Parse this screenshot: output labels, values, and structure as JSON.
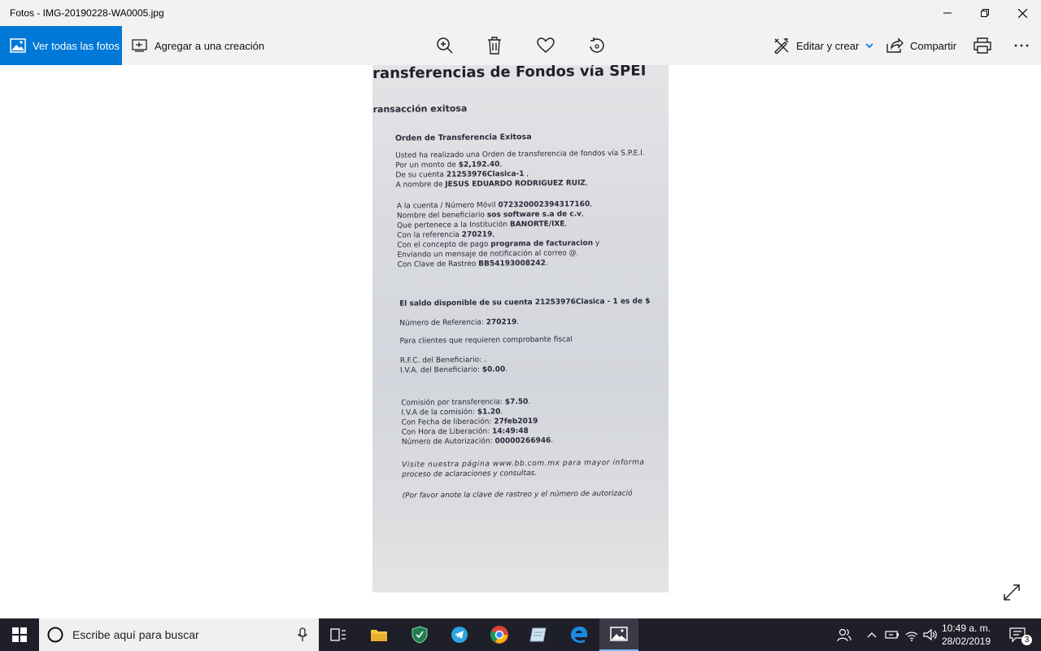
{
  "window": {
    "title": "Fotos - IMG-20190228-WA0005.jpg"
  },
  "toolbar": {
    "see_all": "Ver todas las fotos",
    "add_to_creation": "Agregar a una creación",
    "edit_create": "Editar y crear",
    "share": "Compartir"
  },
  "document": {
    "heading": "ransferencias de Fondos vía SPEI",
    "status": "ransacción exitosa",
    "order_title": "Orden de Transferencia Exitosa",
    "p1": "Usted ha realizado una Orden de transferencia de fondos vía S.P.E.I.",
    "amount_label": "Por un monto de ",
    "amount": "$2,192.40",
    "account_label": "De su cuenta ",
    "account": "21253976Clasica-1",
    "name_label": "A nombre de ",
    "name": "JESUS EDUARDO RODRIGUEZ RUIZ",
    "dest_label": "A la cuenta / Número Móvil ",
    "dest": "072320002394317160",
    "benef_label": "Nombre del beneficiario ",
    "benef": "sos software s.a de c.v",
    "inst_label": "Que pertenece a la Institución ",
    "inst": "BANORTE/IXE",
    "ref_label": "Con la referencia ",
    "ref": "270219",
    "concept_label": "Con el concepto de pago ",
    "concept": "programa de facturacion",
    "concept_tail": " y",
    "notify": "Enviando un mensaje de notificación al correo @.",
    "track_label": "Con Clave de Rastreo ",
    "track": "BB54193008242",
    "balance": "El saldo disponible de su cuenta 21253976Clasica - 1 es de $",
    "refnum_label": "Número de Referencia: ",
    "refnum": "270219",
    "fiscal": "Para clientes que requieren comprobante fiscal",
    "rfc": "R.F.C. del Beneficiario: .",
    "iva_benef_label": "I.V.A. del Beneficiario: ",
    "iva_benef": "$0.00",
    "commission_label": "Comisión por transferencia: ",
    "commission": "$7.50",
    "iva_comm_label": "I.V.A de la comisión: ",
    "iva_comm": "$1.20",
    "date_label": "Con Fecha de liberación: ",
    "date": "27feb2019",
    "time_label": "Con Hora de Liberación: ",
    "time": "14:49:48",
    "auth_label": "Número de Autorización: ",
    "auth": "00000266946",
    "visit1": "Visite nuestra página www.bb.com.mx para mayor informa",
    "visit2": "proceso de aclaraciones y consultas.",
    "note": "(Por favor anote la clave de rastreo y el número de autorizació"
  },
  "taskbar": {
    "search_placeholder": "Escribe aquí para buscar",
    "time": "10:49 a. m.",
    "date": "28/02/2019",
    "notifications": "3"
  },
  "colors": {
    "accent": "#0078d7",
    "taskbar": "#1f1f2a",
    "chrome": "#f2f2f2"
  }
}
